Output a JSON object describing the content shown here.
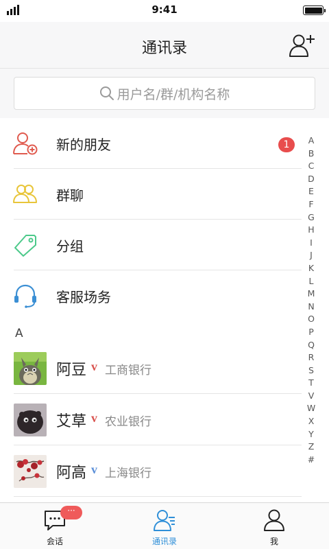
{
  "status_bar": {
    "time": "9:41"
  },
  "header": {
    "title": "通讯录"
  },
  "search": {
    "placeholder": "用户名/群/机构名称"
  },
  "menu_items": [
    {
      "label": "新的朋友",
      "icon": "new-friend-icon",
      "color": "#e05a4e",
      "badge": "1"
    },
    {
      "label": "群聊",
      "icon": "group-chat-icon",
      "color": "#e8c53a"
    },
    {
      "label": "分组",
      "icon": "tag-icon",
      "color": "#4cc98a"
    },
    {
      "label": "客服场务",
      "icon": "headset-icon",
      "color": "#3b8fd4"
    }
  ],
  "section": {
    "letter": "A"
  },
  "contacts": [
    {
      "name": "阿豆",
      "verified": "v",
      "verified_color": "#d9534f",
      "org": "工商银行"
    },
    {
      "name": "艾草",
      "verified": "v",
      "verified_color": "#d9534f",
      "org": "农业银行"
    },
    {
      "name": "阿高",
      "verified": "v",
      "verified_color": "#5b8fd8",
      "org": "上海银行"
    }
  ],
  "alphabet_index": [
    "A",
    "B",
    "C",
    "D",
    "E",
    "F",
    "G",
    "H",
    "I",
    "J",
    "K",
    "L",
    "M",
    "N",
    "O",
    "P",
    "Q",
    "R",
    "S",
    "T",
    "V",
    "W",
    "X",
    "Y",
    "Z",
    "#"
  ],
  "tabs": [
    {
      "label": "会话",
      "icon": "chat-icon",
      "badge": "···"
    },
    {
      "label": "通讯录",
      "icon": "contacts-icon",
      "active": true
    },
    {
      "label": "我",
      "icon": "profile-icon"
    }
  ],
  "colors": {
    "accent": "#2f8fd8",
    "badge": "#e84d4d"
  }
}
